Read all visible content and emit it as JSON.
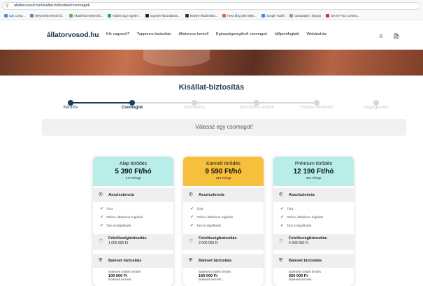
{
  "browser": {
    "url": "allatorvosod.hu/kisallat-biztositas#csomagok",
    "bookmarks": [
      "age Comp...",
      "Helyesírás-ellenőrző...",
      "Akadémiai helyesírá...",
      "Küldni vagy egyéb?...",
      "Egyszer használatos...",
      "Klaviyo-elszámolás...",
      "Hess blog cikk teljes...",
      "Google Tudós",
      "Campaigns | Klaviyo",
      "Set Of Four Commu..."
    ]
  },
  "nav": {
    "logo": "állatorvosod.hu",
    "menu": [
      "Kik vagyunk?",
      "Topponcs biztosítás",
      "Állatorvos kereső",
      "Egészségmegőrző csomagok",
      "Időpontfoglaló",
      "Webáruház"
    ]
  },
  "page": {
    "title": "Kisállat-biztosítás",
    "choose": "Válassz egy csomagot!",
    "steps": [
      "Kérdőív",
      "Csomagok",
      "Azonosítás",
      "Szerződési adatok",
      "Fizetési feltételek",
      "Véglegesítés"
    ]
  },
  "cards": [
    {
      "name": "Alap törődés",
      "price": "5 390 Ft/hó",
      "daily": "177 Ft/nap",
      "color": "#b8ede8",
      "assist": "Asszisztencia",
      "items": [
        "7/24",
        "Online általános foglalás",
        "Taxi szolgáltatás"
      ],
      "liab": "Felelősségbiztosítás",
      "liab_val": "1 000 000 Ft",
      "accident": "Baleset biztosítás",
      "sub_label": "Baleseti műtéti térítés",
      "sub_val": "100 000 Ft",
      "sub2": "Baleseti kezelé..."
    },
    {
      "name": "Kiemelt törődés",
      "price": "9 590 Ft/hó",
      "daily": "315 Ft/nap",
      "color": "#f6c03c",
      "assist": "Asszisztencia",
      "items": [
        "7/24",
        "Online általános foglalás",
        "Taxi szolgáltatás"
      ],
      "liab": "Felelősségbiztosítás",
      "liab_val": "2 000 000 Ft",
      "accident": "Baleset biztosítás",
      "sub_label": "Baleseti műtéti térítés",
      "sub_val": "150 000 Ft",
      "sub2": "Baleseti kezelé..."
    },
    {
      "name": "Prémium törődés",
      "price": "12 190 Ft/hó",
      "daily": "401 Ft/nap",
      "color": "#b8ede8",
      "assist": "Asszisztencia",
      "items": [
        "7/24",
        "Online általános foglalás",
        "Taxi szolgáltatás"
      ],
      "liab": "Felelősségbiztosítás",
      "liab_val": "4 000 000 Ft",
      "accident": "Baleset biztosítás",
      "sub_label": "Baleseti műtéti térítés",
      "sub_val": "250 000 Ft",
      "sub2": "Baleseti kezelé..."
    }
  ]
}
